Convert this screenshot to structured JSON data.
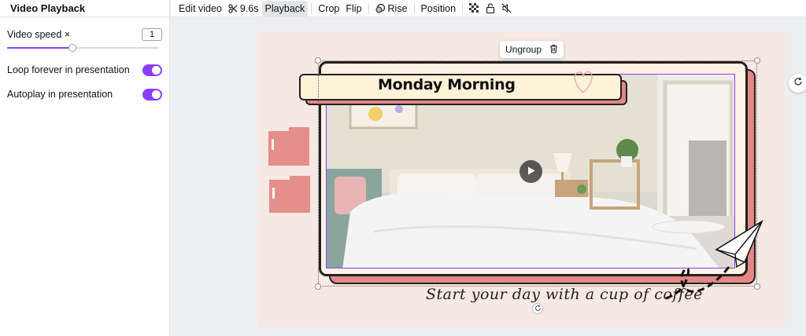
{
  "panel": {
    "title": "Video Playback",
    "speed_label": "Video speed ×",
    "speed_value": "1",
    "speed_slider_fraction": 0.43,
    "loop_label": "Loop forever in presentation",
    "loop_on": true,
    "autoplay_label": "Autoplay in presentation",
    "autoplay_on": true
  },
  "toolbar": {
    "edit_video": "Edit video",
    "duration": "9.6s",
    "playback": "Playback",
    "crop": "Crop",
    "flip": "Flip",
    "rise": "Rise",
    "position": "Position",
    "icons": [
      "scissors-icon",
      "rise-icon",
      "transparency-icon",
      "lock-icon",
      "mute-icon"
    ]
  },
  "canvas": {
    "ungroup_label": "Ungroup",
    "banner_title": "Monday Morning",
    "tagline": "Start your day with a cup of coffee",
    "icons": [
      "trash-icon",
      "play-icon",
      "refresh-icon",
      "paper-plane-icon",
      "heart-icon",
      "folder-icon"
    ]
  },
  "colors": {
    "accent": "#8b3dff",
    "frame_pink": "#e48784",
    "banner_fill": "#fdf3d8",
    "page_bg": "#f6e8e2"
  }
}
